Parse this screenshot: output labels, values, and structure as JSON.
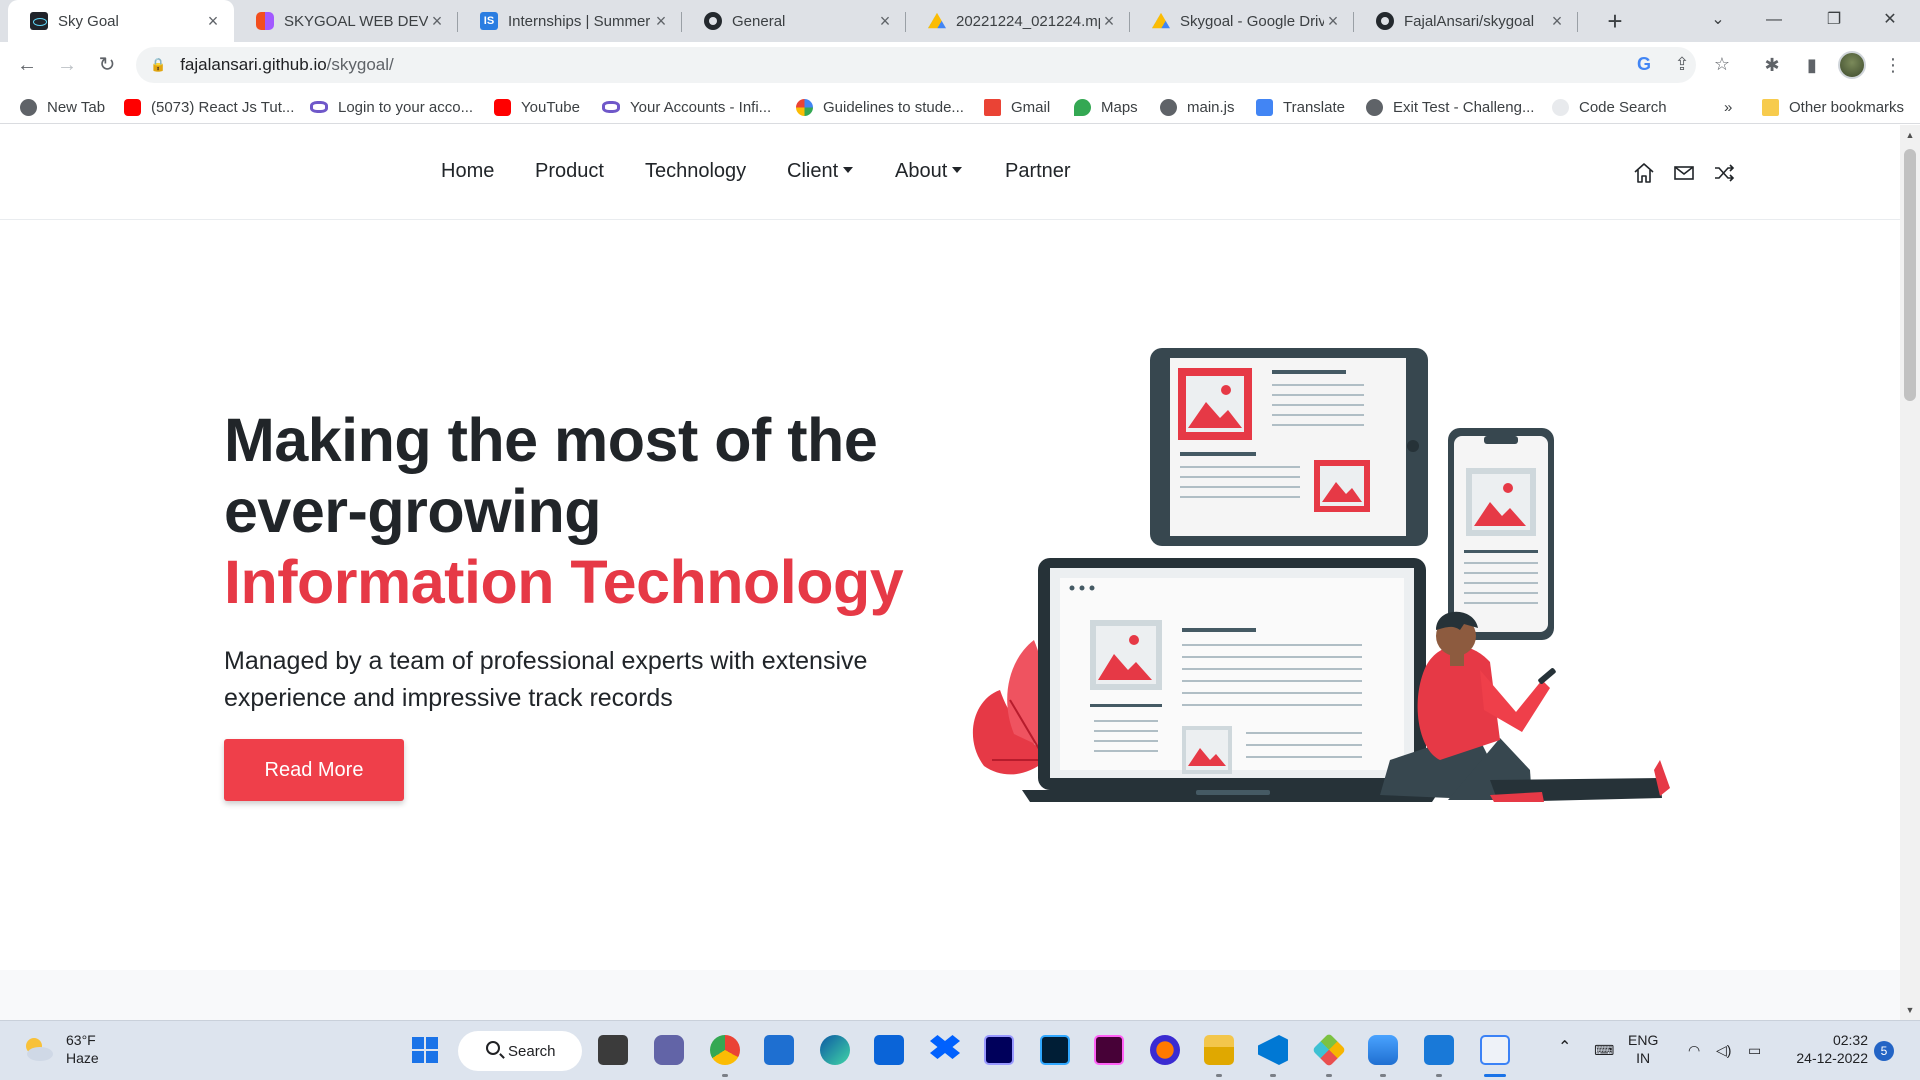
{
  "browser": {
    "tabs": [
      {
        "title": "Sky Goal",
        "favicon": "react-icon",
        "active": true
      },
      {
        "title": "SKYGOAL WEB DEVEL",
        "favicon": "figma-icon"
      },
      {
        "title": "Internships | Summer",
        "favicon": "internshala-icon"
      },
      {
        "title": "General",
        "favicon": "github-icon"
      },
      {
        "title": "20221224_021224.mp",
        "favicon": "google-drive-icon"
      },
      {
        "title": "Skygoal - Google Driv",
        "favicon": "google-drive-icon"
      },
      {
        "title": "FajalAnsari/skygoal",
        "favicon": "github-icon"
      }
    ],
    "url_host": "fajalansari.github.io",
    "url_path": "/skygoal/",
    "bookmarks": [
      {
        "label": "New Tab",
        "icon": "globe-icon"
      },
      {
        "label": "(5073) React Js Tut...",
        "icon": "youtube-icon"
      },
      {
        "label": "Login to your acco...",
        "icon": "infinity-icon"
      },
      {
        "label": "YouTube",
        "icon": "youtube-icon"
      },
      {
        "label": "Your Accounts - Infi...",
        "icon": "infinity-icon"
      },
      {
        "label": "Guidelines to stude...",
        "icon": "google-icon"
      },
      {
        "label": "Gmail",
        "icon": "gmail-icon"
      },
      {
        "label": "Maps",
        "icon": "maps-icon"
      },
      {
        "label": "main.js",
        "icon": "globe-icon"
      },
      {
        "label": "Translate",
        "icon": "translate-icon"
      },
      {
        "label": "Exit Test - Challeng...",
        "icon": "globe-icon"
      },
      {
        "label": "Code Search",
        "icon": "code-search-icon"
      }
    ],
    "bookmarks_overflow": "»",
    "other_bookmarks": "Other bookmarks"
  },
  "site": {
    "nav": [
      {
        "label": "Home"
      },
      {
        "label": "Product"
      },
      {
        "label": "Technology"
      },
      {
        "label": "Client",
        "dropdown": true
      },
      {
        "label": "About",
        "dropdown": true
      },
      {
        "label": "Partner"
      }
    ],
    "nav_icons": [
      "home-icon",
      "mail-icon",
      "shuffle-icon"
    ],
    "hero": {
      "title_line1": "Making the most of the",
      "title_line2": "ever-growing",
      "title_accent": "Information Technology",
      "subtitle": "Managed by a team of professional experts with extensive experience and impressive track records",
      "cta": "Read More"
    },
    "colors": {
      "accent": "#e63946",
      "button": "#ef3f4a",
      "dark": "#37474f"
    }
  },
  "taskbar": {
    "weather_temp": "63°F",
    "weather_desc": "Haze",
    "search": "Search",
    "lang_1": "ENG",
    "lang_2": "IN",
    "time": "02:32",
    "date": "24-12-2022",
    "notifications": "5"
  }
}
